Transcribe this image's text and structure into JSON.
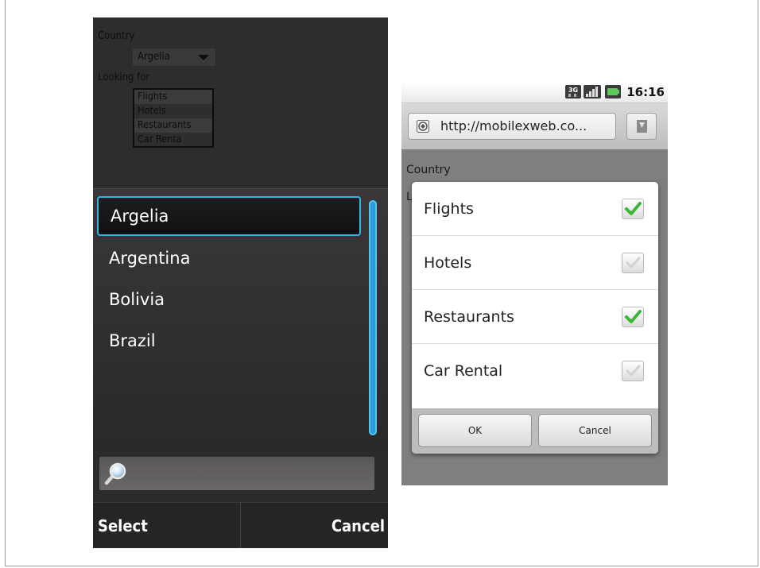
{
  "symbian": {
    "page": {
      "country_label": "Country",
      "country_value": "Argelia",
      "looking_label": "Looking for",
      "options": [
        "Flights",
        "Hotels",
        "Restaurants",
        "Car Renta"
      ]
    },
    "list": {
      "items": [
        "Argelia",
        "Argentina",
        "Bolivia",
        "Brazil"
      ],
      "selected_index": 0
    },
    "search": {
      "icon": "magnifier-icon",
      "value": ""
    },
    "softkeys": {
      "left": "Select",
      "right": "Cancel"
    }
  },
  "android": {
    "status": {
      "time": "16:16",
      "icons": [
        "3g-icon",
        "signal-icon",
        "battery-icon"
      ]
    },
    "url_bar": {
      "url": "http://mobilexweb.co...",
      "icon": "globe-icon",
      "bookmark_icon": "bookmark-icon"
    },
    "page": {
      "country_label": "Country",
      "partial_label": "L"
    },
    "dialog": {
      "items": [
        {
          "label": "Flights",
          "checked": true
        },
        {
          "label": "Hotels",
          "checked": false
        },
        {
          "label": "Restaurants",
          "checked": true
        },
        {
          "label": "Car Rental",
          "checked": false
        }
      ],
      "ok_label": "OK",
      "cancel_label": "Cancel"
    }
  },
  "colors": {
    "symbian_highlight": "#34b6e8",
    "android_check": "#3bb83b"
  }
}
